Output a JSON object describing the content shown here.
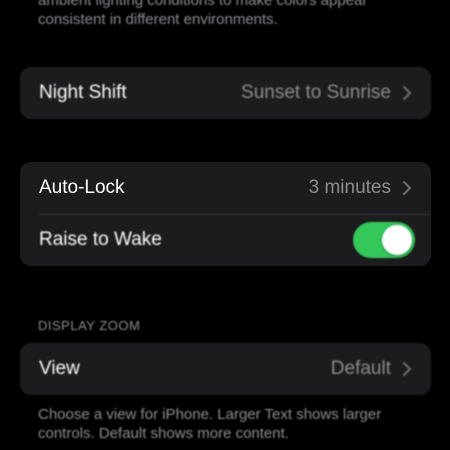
{
  "colors": {
    "background": "#000000",
    "cell": "#1c1c1e",
    "separator": "#38383a",
    "secondary_text": "#8d8d92",
    "toggle_on": "#34c759"
  },
  "true_tone": {
    "footnote_line1": "ambient lighting conditions to make colors appear",
    "footnote_line2": "consistent in different environments."
  },
  "night_shift": {
    "label": "Night Shift",
    "value": "Sunset to Sunrise",
    "icon": "chevron-right-icon"
  },
  "auto_lock": {
    "label": "Auto-Lock",
    "value": "3 minutes",
    "icon": "chevron-right-icon"
  },
  "raise_to_wake": {
    "label": "Raise to Wake",
    "enabled": true
  },
  "display_zoom": {
    "header": "DISPLAY ZOOM",
    "view_label": "View",
    "view_value": "Default",
    "icon": "chevron-right-icon",
    "footnote_line1": "Choose a view for iPhone. Larger Text shows larger",
    "footnote_line2": "controls. Default shows more content."
  }
}
